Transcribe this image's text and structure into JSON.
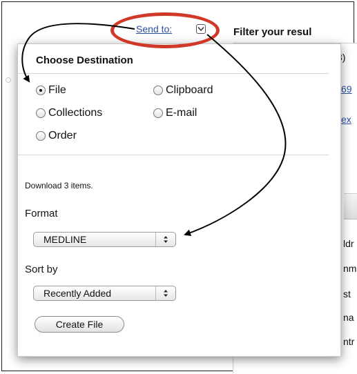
{
  "header": {
    "send_to_label": "Send to:",
    "filter_title": "Filter your resul"
  },
  "background": {
    "fragments": [
      "3)",
      "69",
      "ex",
      "ldr",
      "nm",
      "st",
      "na",
      "ntr"
    ]
  },
  "popup": {
    "heading": "Choose Destination",
    "destinations": [
      {
        "label": "File",
        "selected": true
      },
      {
        "label": "Clipboard",
        "selected": false
      },
      {
        "label": "Collections",
        "selected": false
      },
      {
        "label": "E-mail",
        "selected": false
      },
      {
        "label": "Order",
        "selected": false
      }
    ],
    "download_text": "Download 3 items.",
    "format_label": "Format",
    "format_value": "MEDLINE",
    "sort_label": "Sort by",
    "sort_value": "Recently Added",
    "create_button": "Create File"
  },
  "colors": {
    "annotation_red": "#d0392a",
    "link_blue": "#2a4fa8"
  },
  "icons": {
    "send_to_dropdown": "chevron-down-icon",
    "select_arrows": "updown-arrows-icon"
  }
}
